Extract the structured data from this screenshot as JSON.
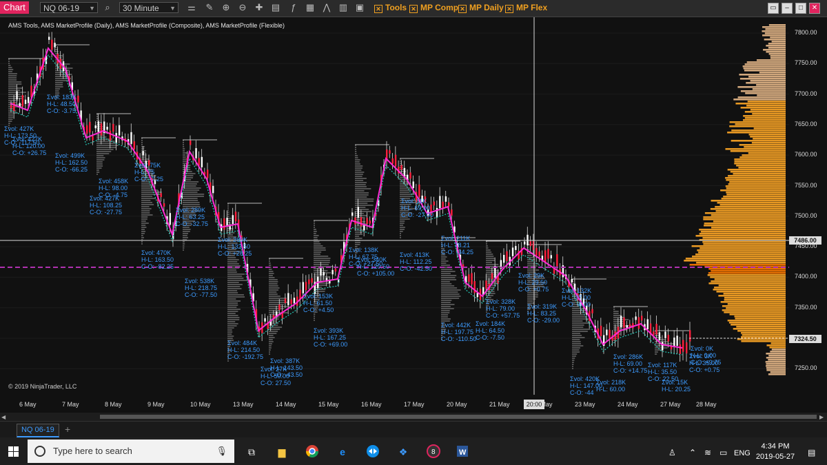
{
  "toolbar": {
    "chart_tab": "Chart",
    "instrument": "NQ 06-19",
    "interval": "30 Minute",
    "checks": [
      "Tools",
      "MP Comp",
      "MP Daily",
      "MP Flex"
    ]
  },
  "chart": {
    "title": "AMS Tools, AMS MarketProfile (Daily), AMS MarketProfile (Composite), AMS MarketProfile (Flexible)",
    "copyright": "© 2019 NinjaTrader, LLC",
    "price_ticks": [
      "7800.00",
      "7750.00",
      "7700.00",
      "7650.00",
      "7600.00",
      "7550.00",
      "7500.00",
      "7450.00",
      "7400.00",
      "7350.00",
      "7300.00",
      "7250.00"
    ],
    "crosshair_price": "7486.00",
    "last_price": "7324.50",
    "crosshair_time": "20:00",
    "dates": [
      "6 May",
      "7 May",
      "8 May",
      "9 May",
      "10 May",
      "13 May",
      "14 May",
      "15 May",
      "16 May",
      "17 May",
      "20 May",
      "21 May",
      "22 May",
      "23 May",
      "24 May",
      "27 May",
      "28 May"
    ],
    "stat_blocks": [
      {
        "text": "Σvol: 183K\nH-L: 48.50\nC-O: -3.75"
      },
      {
        "text": "Σvol: 427K\nH-L: 173.50\nC-O: -117.50"
      },
      {
        "text": "Σvol: 427K\nH-L: 120.00\nC-O: +26.75"
      },
      {
        "text": "Σvol: 499K\nH-L: 162.50\nC-O: -66.25"
      },
      {
        "text": "Σvol: 458K\nH-L: 98.00\nC-O: -4.75"
      },
      {
        "text": "Σvol: 427K\nH-L: 108.25\nC-O: -27.75"
      },
      {
        "text": "Σvol: 75K\nH-L: 75\nC-O: -7.25"
      },
      {
        "text": "Σvol: 470K\nH-L: 163.50\nC-O: -82.25"
      },
      {
        "text": "Σvol: 289K\nH-L: 63.25\nC-O: -32.75"
      },
      {
        "text": "Σvol: 538K\nH-L: 218.75\nC-O: -77.50"
      },
      {
        "text": "Σvol: 269K\nH-L: 132.50\nC-O: +26.25"
      },
      {
        "text": "Σvol: 484K\nH-L: 214.50\nC-O: -192.75"
      },
      {
        "text": "Σvol: 387K\nH-L: 143.50\nC-O: -43.50"
      },
      {
        "text": "Σvol: 27K\nH-L: 50.00\nC-O: 27.50"
      },
      {
        "text": "Σvol: 153K\nH-L: 61.50\nC-O: +4.50"
      },
      {
        "text": "Σvol: 393K\nH-L: 167.25\nC-O: +69.00"
      },
      {
        "text": "Σvol: 138K\nH-L: 67.75\nC-O: +27.50"
      },
      {
        "text": "Σvol: 340K\nH-L: 120.50\nC-O: +105.00"
      },
      {
        "text": "Σvol: 413K\nH-L: 112.25\nC-O: -42.50"
      },
      {
        "text": "Σvol: 11K\nH-L: 69.00\nC-O: -27.00"
      },
      {
        "text": "Σvol: 211K\nH-L: 78.21\nC-O: -34.25"
      },
      {
        "text": "Σvol: 442K\nH-L: 197.75\nC-O: -110.50"
      },
      {
        "text": "Σvol: 328K\nH-L: 79.00\nC-O: +57.75"
      },
      {
        "text": "Σvol: 184K\nH-L: 64.50\nC-O: -7.50"
      },
      {
        "text": "Σvol: 319K\nH-L: 83.25\nC-O: -29.00"
      },
      {
        "text": "Σvol: 29K\nH-L: 29.50\nC-O: +0.75"
      },
      {
        "text": "Σvol: 132K\nH-L: 37.00\nC-O: -6.00"
      },
      {
        "text": "Σvol: 420K\nH-L: 147.00\nC-O: -44"
      },
      {
        "text": "Σvol: 286K\nH-L: 69.00\nC-O: +14.75"
      },
      {
        "text": "Σvol: 218K\nH-L: 60.00"
      },
      {
        "text": "Σvol: 117K\nH-L: 35.50\nC-O: 22.50"
      },
      {
        "text": "Σvol: 3K\nH-L: 35.00\nC-O: +0.75"
      },
      {
        "text": "Σvol: 0K\nH-L: 0.00\nC-O: +9.75"
      },
      {
        "text": "Σvol: 15K\nH-L: 20.25"
      }
    ]
  },
  "tabs": {
    "active": "NQ 06-19",
    "add": "+"
  },
  "taskbar": {
    "search_placeholder": "Type here to search",
    "lang": "ENG",
    "time": "4:34 PM",
    "date": "2019-05-27"
  }
}
